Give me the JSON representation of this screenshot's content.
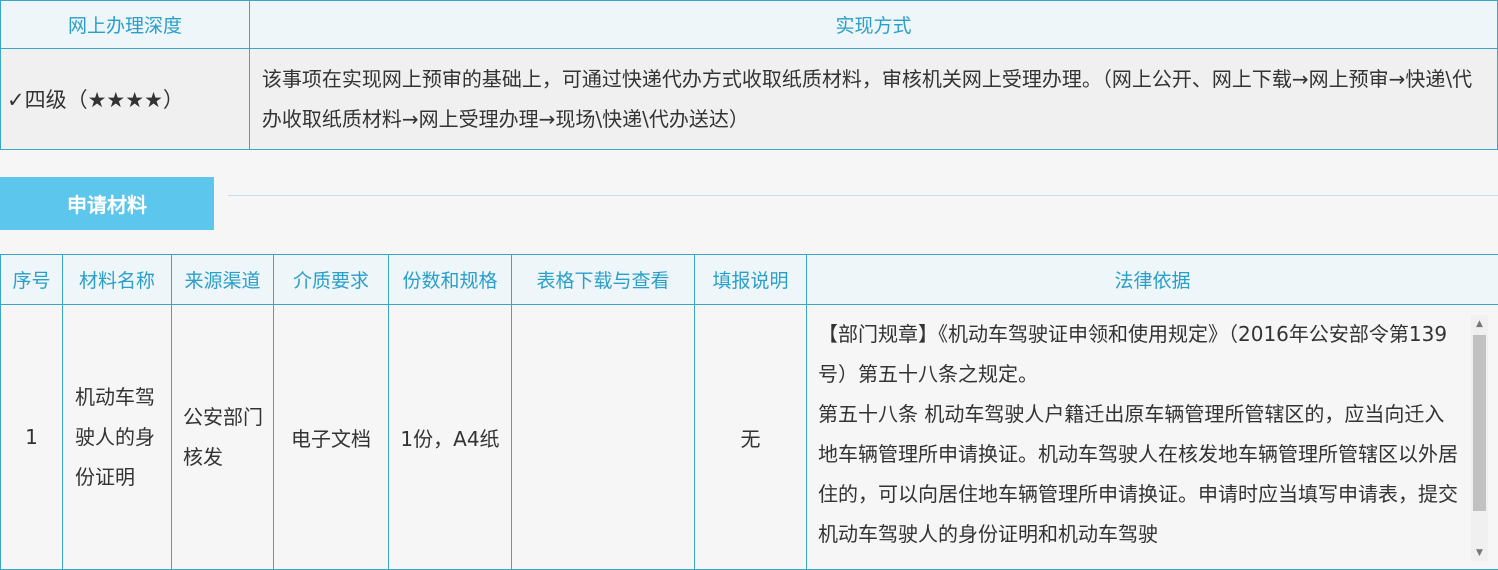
{
  "depth": {
    "header_depth": "网上办理深度",
    "header_method": "实现方式",
    "level": "✓四级（★★★★）",
    "description": "该事项在实现网上预审的基础上，可通过快递代办方式收取纸质材料，审核机关网上受理办理。（网上公开、网上下载→网上预审→快递\\代办收取纸质材料→网上受理办理→现场\\快递\\代办送达）"
  },
  "section": {
    "title": "申请材料"
  },
  "materials": {
    "headers": [
      "序号",
      "材料名称",
      "来源渠道",
      "介质要求",
      "份数和规格",
      "表格下载与查看",
      "填报说明",
      "法律依据"
    ],
    "rows": [
      {
        "index": "1",
        "name": "机动车驾驶人的身份证明",
        "source": "公安部门核发",
        "medium": "电子文档",
        "copies": "1份，A4纸",
        "download": "",
        "notes": "无",
        "law": "【部门规章】《机动车驾驶证申领和使用规定》（2016年公安部令第139号）第五十八条之规定。\n第五十八条 机动车驾驶人户籍迁出原车辆管理所管辖区的，应当向迁入地车辆管理所申请换证。机动车驾驶人在核发地车辆管理所管辖区以外居住的，可以向居住地车辆管理所申请换证。申请时应当填写申请表，提交机动车驾驶人的身份证明和机动车驾驶"
      }
    ]
  },
  "colors": {
    "accent": "#5cc6ec",
    "border": "#3ba6c8",
    "header_text": "#2a9fc9"
  },
  "icons": {
    "scroll_up": "scroll-up-arrow-icon",
    "scroll_down": "scroll-down-arrow-icon"
  }
}
